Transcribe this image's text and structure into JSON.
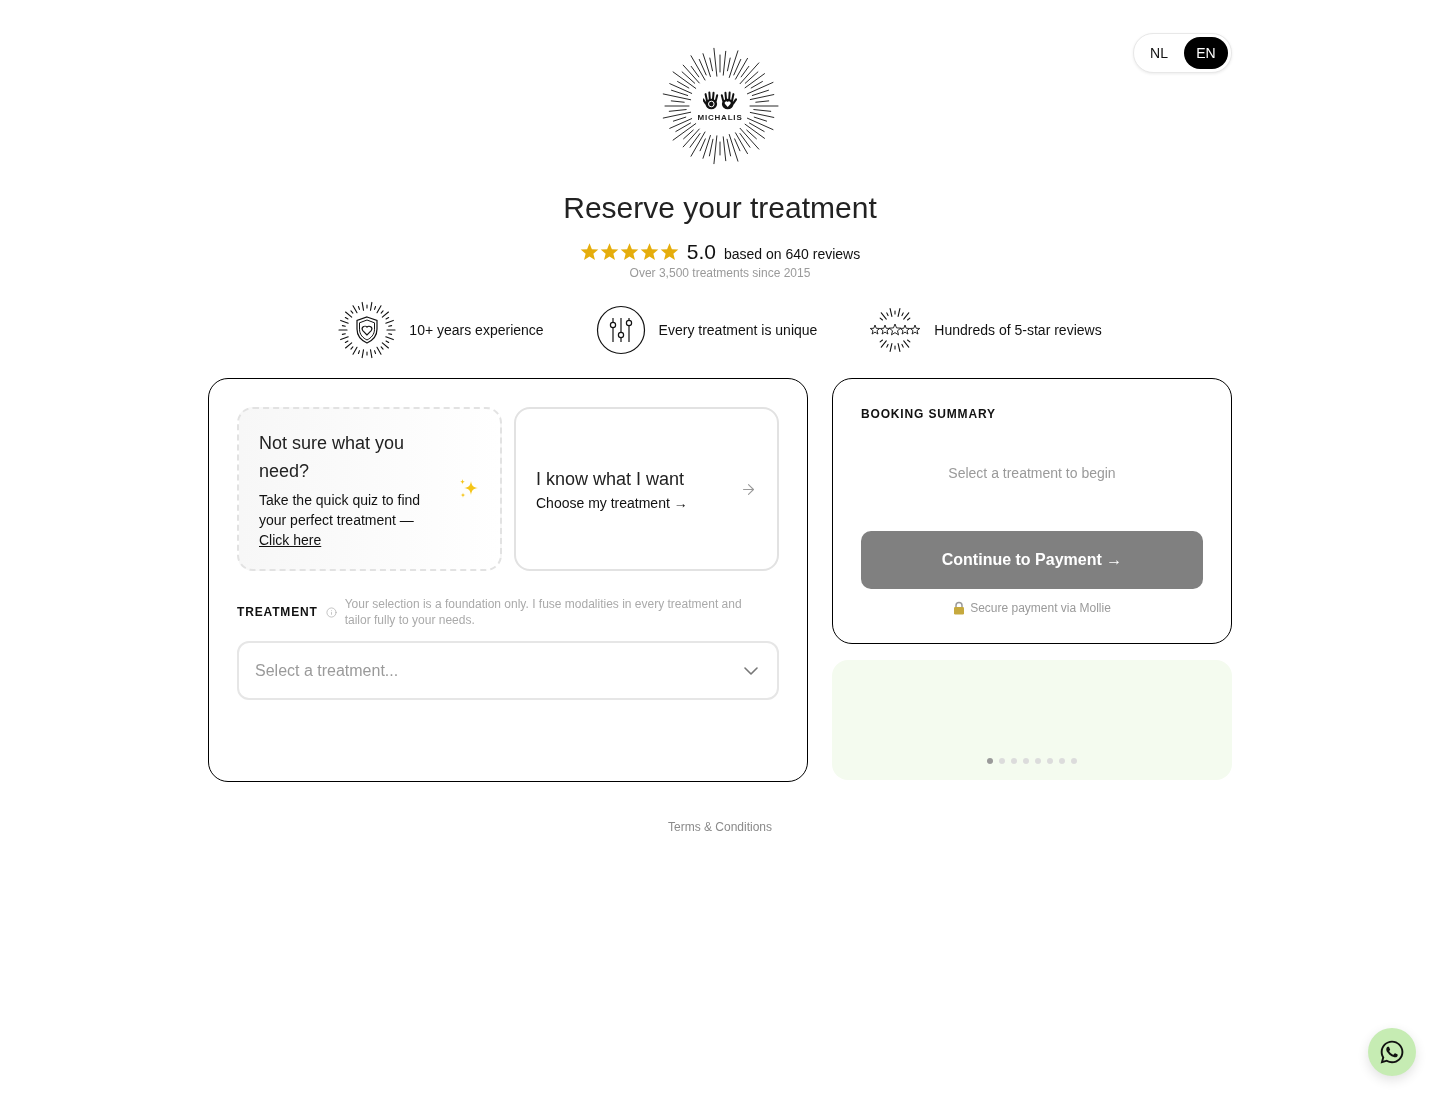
{
  "language_switch": [
    {
      "label": "NL",
      "selected": false
    },
    {
      "label": "EN",
      "selected": true
    }
  ],
  "logo": {
    "text": "MICHALIS"
  },
  "title": "Reserve your treatment",
  "rating": {
    "stars": 5,
    "score": "5.0",
    "text": "based on 640 reviews",
    "subtext": "Over 3,500 treatments since 2015"
  },
  "features": [
    {
      "kind": "shield",
      "label": "10+ years experience"
    },
    {
      "kind": "sliders",
      "label": "Every treatment is unique"
    },
    {
      "kind": "stars",
      "label": "Hundreds of 5-star reviews"
    }
  ],
  "options": [
    {
      "kind": "quiz",
      "title": "Not sure what you need?",
      "text": "Take the quick quiz to find your perfect treatment —",
      "link": "Click here"
    },
    {
      "kind": "direct",
      "title": "I know what I want",
      "link": "Choose my treatment →"
    }
  ],
  "treatment_field": {
    "label": "TREATMENT",
    "hint": "Your selection is a foundation only. I fuse modalities in every treatment and tailor fully to your needs.",
    "placeholder": "Select a treatment..."
  },
  "booking_summary": {
    "title": "BOOKING SUMMARY",
    "empty_text": "Select a treatment to begin",
    "button": {
      "label": "Continue to Payment →",
      "disabled": true
    },
    "secure_note": "Secure payment via Mollie"
  },
  "carousel": {
    "dots": [
      {
        "selected": true
      },
      {
        "selected": false
      },
      {
        "selected": false
      },
      {
        "selected": false
      },
      {
        "selected": false
      },
      {
        "selected": false
      },
      {
        "selected": false
      },
      {
        "selected": false
      }
    ]
  },
  "footer": {
    "link": "Terms & Conditions"
  }
}
